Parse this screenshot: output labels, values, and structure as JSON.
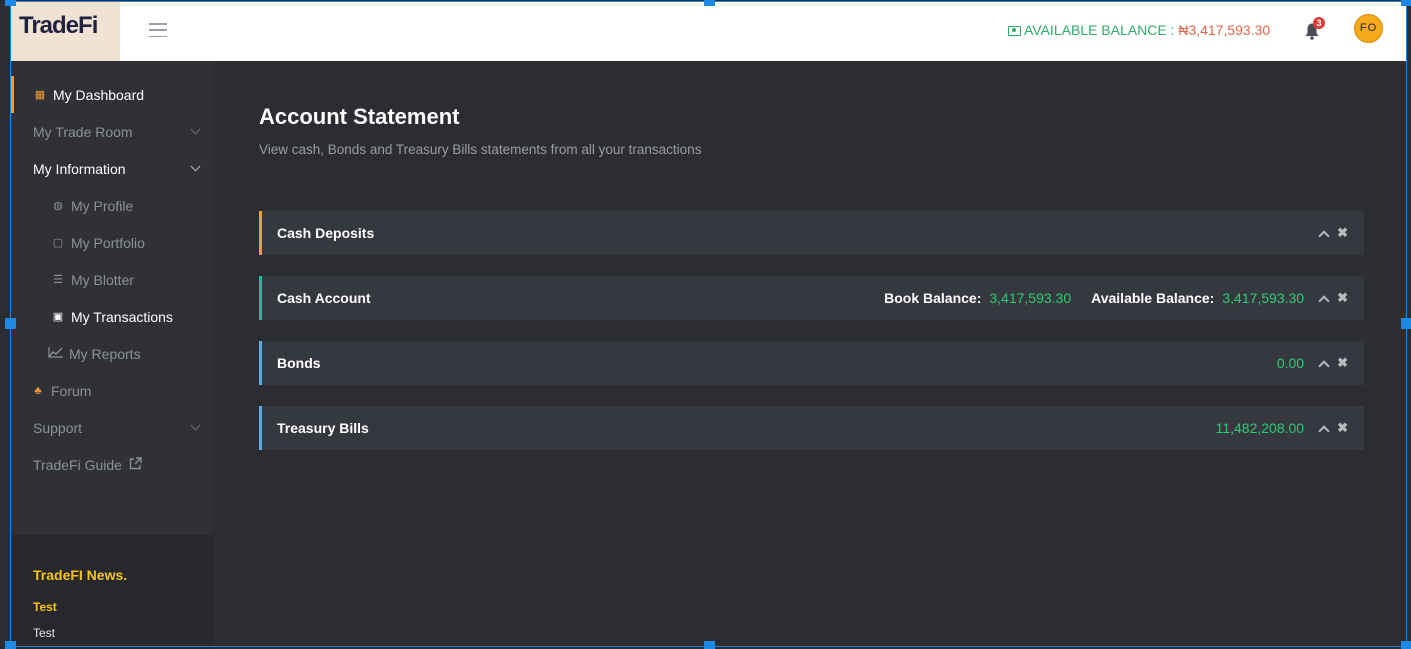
{
  "header": {
    "logo_text": "TradeFi",
    "balance_label": "AVAILABLE BALANCE : ",
    "balance_value": "₦3,417,593.30",
    "notification_count": "3",
    "avatar_initials": "FO"
  },
  "sidebar": {
    "items": [
      {
        "label": "My Dashboard"
      },
      {
        "label": "My Trade Room"
      },
      {
        "label": "My Information"
      },
      {
        "label": "My Profile"
      },
      {
        "label": "My Portfolio"
      },
      {
        "label": "My Blotter"
      },
      {
        "label": "My Transactions"
      },
      {
        "label": "My Reports"
      },
      {
        "label": "Forum"
      },
      {
        "label": "Support"
      },
      {
        "label": "TradeFi Guide"
      }
    ],
    "news_title": "TradeFI News.",
    "news_items": [
      "Test",
      "Test"
    ]
  },
  "main": {
    "title": "Account Statement",
    "subtitle": "View cash, Bonds and Treasury Bills statements from all your transactions",
    "panels": [
      {
        "title": "Cash Deposits",
        "accent": "#f39c34"
      },
      {
        "title": "Cash Account",
        "accent": "#1abc9c",
        "book_label": "Book Balance:",
        "book_value": "3,417,593.30",
        "avail_label": "Available Balance:",
        "avail_value": "3,417,593.30"
      },
      {
        "title": "Bonds",
        "accent": "#5dade2",
        "value": "0.00"
      },
      {
        "title": "Treasury Bills",
        "accent": "#5dade2",
        "value": "11,482,208.00"
      }
    ]
  },
  "colors": {
    "balance_green": "#2eac6c",
    "balance_orange": "#e0664a",
    "value_green": "#2ecc71",
    "news_yellow": "#f5c518"
  },
  "icons": {
    "dashboard": "dashboard-icon",
    "profile": "profile-icon",
    "portfolio": "portfolio-icon",
    "blotter": "blotter-icon",
    "transactions": "transactions-icon",
    "reports": "chart-line-icon",
    "forum": "forum-icon",
    "external": "external-link-icon"
  }
}
